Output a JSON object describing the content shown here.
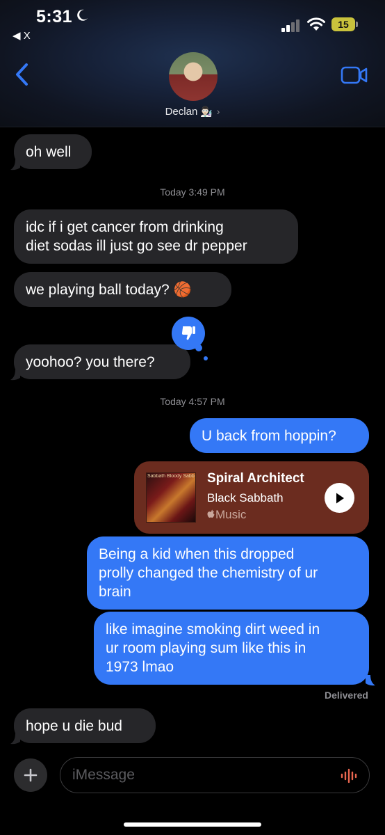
{
  "status_bar": {
    "time": "5:31",
    "back_app": "◀ X",
    "battery": "15"
  },
  "header": {
    "contact_name": "Declan",
    "contact_emoji": "👨🏻‍🔬",
    "chevron": "›"
  },
  "messages": [
    {
      "id": "m1",
      "direction": "incoming",
      "text": "oh well"
    },
    {
      "id": "ts1",
      "type": "timestamp",
      "day": "Today",
      "time": "3:49 PM"
    },
    {
      "id": "m2",
      "direction": "incoming",
      "lines": [
        "idc if i get cancer from drinking",
        "diet sodas ill just go see dr pepper"
      ]
    },
    {
      "id": "m3",
      "direction": "incoming",
      "text": "we playing ball today? 🏀"
    },
    {
      "id": "m4",
      "direction": "incoming",
      "text": "yoohoo? you there?",
      "tapback": "thumbs-down"
    },
    {
      "id": "ts2",
      "type": "timestamp",
      "day": "Today",
      "time": "4:57 PM"
    },
    {
      "id": "m5",
      "direction": "outgoing",
      "text": "U back from hoppin?"
    },
    {
      "id": "m6",
      "direction": "outgoing",
      "type": "music",
      "song": "Spiral Architect",
      "artist": "Black Sabbath",
      "source": "Music",
      "album_art_text": "Sabbath Bloody Sabbath"
    },
    {
      "id": "m7",
      "direction": "outgoing",
      "lines": [
        "Being a kid when this dropped",
        "prolly changed the chemistry of ur",
        "brain"
      ]
    },
    {
      "id": "m8",
      "direction": "outgoing",
      "lines": [
        "like imagine smoking dirt weed in",
        "ur room playing sum like this in",
        "1973 lmao"
      ]
    },
    {
      "id": "m9",
      "direction": "incoming",
      "text": "hope u die bud"
    }
  ],
  "delivered_label": "Delivered",
  "composer": {
    "placeholder": "iMessage",
    "plus": "+"
  },
  "colors": {
    "outgoing_bubble": "#3478f6",
    "incoming_bubble": "#262629",
    "music_card": "#6b2c1f",
    "accent": "#3478f6"
  },
  "icons": [
    "moon-icon",
    "signal-icon",
    "wifi-icon",
    "battery-icon",
    "back-chevron-icon",
    "video-call-icon",
    "thumbs-down-icon",
    "play-icon",
    "apple-logo-icon",
    "plus-icon",
    "audio-waveform-icon"
  ]
}
